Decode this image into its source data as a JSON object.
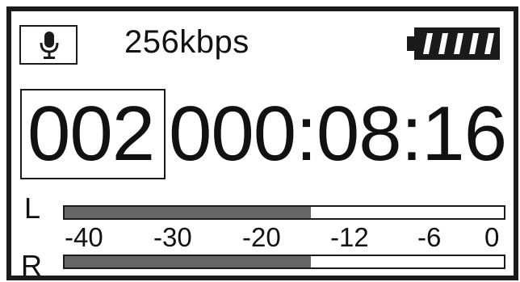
{
  "header": {
    "mic_icon": "microphone-icon",
    "bitrate": "256kbps",
    "battery_icon": "battery-icon"
  },
  "display": {
    "track_number": "002",
    "elapsed_time": "000:08:16"
  },
  "meters": {
    "left_label": "L",
    "right_label": "R",
    "left_level": 0.56,
    "right_level": 0.56,
    "fill_color": "#666666",
    "scale": [
      "-40",
      "-30",
      "-20",
      "-12",
      "-6",
      "0"
    ]
  }
}
